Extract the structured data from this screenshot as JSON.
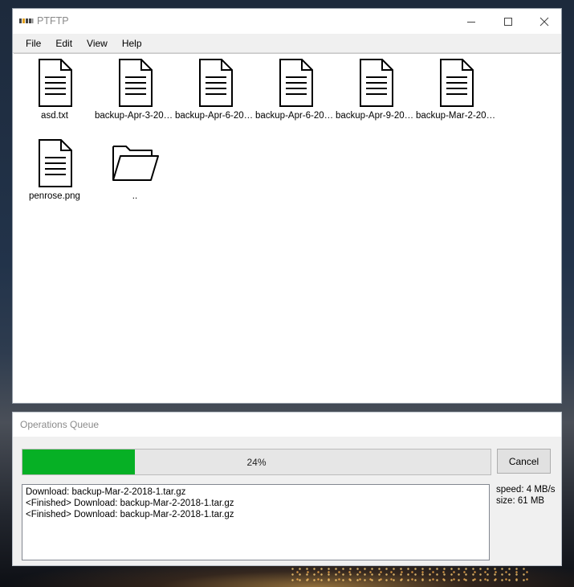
{
  "window": {
    "title": "PTFTP",
    "logo_text": "PTFTP"
  },
  "menu": [
    {
      "label": "File"
    },
    {
      "label": "Edit"
    },
    {
      "label": "View"
    },
    {
      "label": "Help"
    }
  ],
  "files": [
    {
      "name": "asd.txt",
      "icon": "document-icon"
    },
    {
      "name": "backup-Apr-3-201...",
      "icon": "document-icon"
    },
    {
      "name": "backup-Apr-6-201...",
      "icon": "document-icon"
    },
    {
      "name": "backup-Apr-6-201...",
      "icon": "document-icon"
    },
    {
      "name": "backup-Apr-9-201...",
      "icon": "document-icon"
    },
    {
      "name": "backup-Mar-2-201...",
      "icon": "document-icon"
    },
    {
      "name": "penrose.png",
      "icon": "document-icon"
    },
    {
      "name": "..",
      "icon": "folder-open-icon"
    }
  ],
  "queue": {
    "title": "Operations Queue",
    "progress_percent": 24,
    "progress_label": "24%",
    "cancel_label": "Cancel",
    "log": [
      "Download: backup-Mar-2-2018-1.tar.gz",
      "<Finished> Download: backup-Mar-2-2018-1.tar.gz",
      "<Finished> Download: backup-Mar-2-2018-1.tar.gz"
    ],
    "speed": "speed: 4 MB/s",
    "size": "size: 61 MB"
  },
  "colors": {
    "progress_fill": "#06b025",
    "title_text": "#8a8a8a"
  }
}
